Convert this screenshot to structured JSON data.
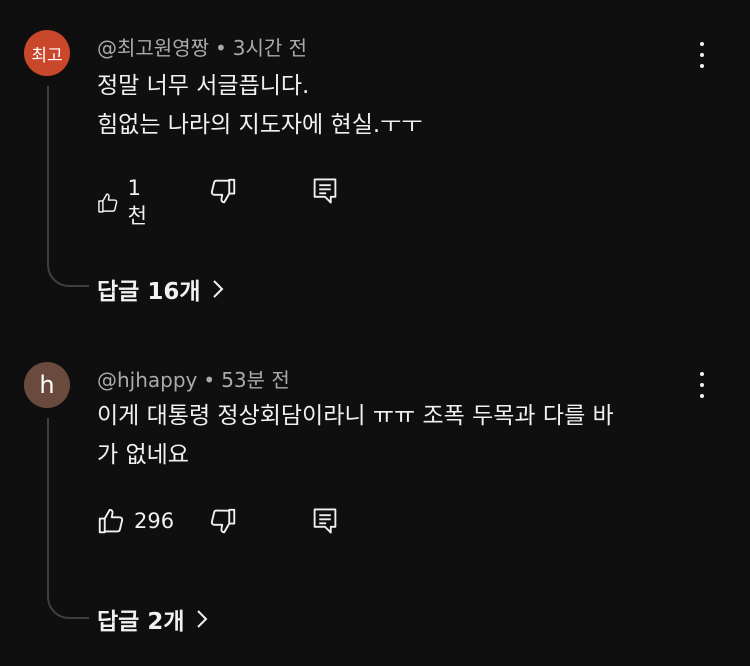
{
  "comments": [
    {
      "avatar_text": "최고",
      "avatar_color": "#c9472a",
      "author": "@최고원영짱",
      "time": "3시간 전",
      "lines": [
        "정말 너무 서글픕니다.",
        "힘없는 나라의 지도자에 현실.ㅜㅜ"
      ],
      "likes": "1천",
      "replies_label": "답글 16개"
    },
    {
      "avatar_text": "h",
      "avatar_color": "#6b4a3e",
      "author": "@hjhappy",
      "time": "53분 전",
      "lines": [
        "이게 대통령 정상회담이라니 ㅠㅠ 조폭 두목과 다를 바",
        "가 없네요"
      ],
      "likes": "296",
      "replies_label": "답글 2개"
    }
  ],
  "separator_dot": "•",
  "icons": {
    "like": "thumbs-up-icon",
    "dislike": "thumbs-down-icon",
    "reply": "reply-comment-icon",
    "more": "more-vertical-icon",
    "expand": "chevron-right-icon"
  }
}
